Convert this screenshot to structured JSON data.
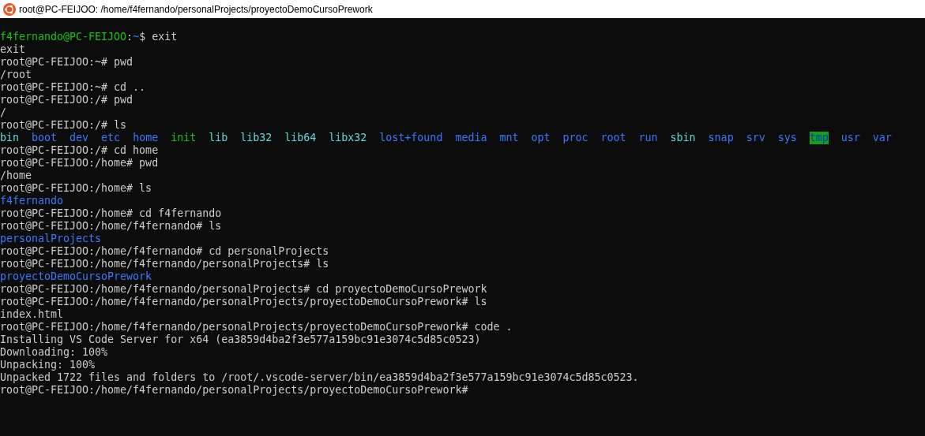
{
  "window": {
    "title": "root@PC-FEIJOO: /home/f4fernando/personalProjects/proyectoDemoCursoPrework"
  },
  "terminal": {
    "lines": [
      {
        "kind": "text",
        "segments": [
          {
            "text": "f4fernando@PC-FEIJOO",
            "kind": "user"
          },
          {
            "text": ":",
            "kind": "plain"
          },
          {
            "text": "~",
            "kind": "path"
          },
          {
            "text": "$ exit",
            "kind": "plain"
          }
        ]
      },
      {
        "kind": "text",
        "segments": [
          {
            "text": "exit",
            "kind": "plain"
          }
        ]
      },
      {
        "kind": "text",
        "segments": [
          {
            "text": "root@PC-FEIJOO:~# pwd",
            "kind": "plain"
          }
        ]
      },
      {
        "kind": "text",
        "segments": [
          {
            "text": "/root",
            "kind": "plain"
          }
        ]
      },
      {
        "kind": "text",
        "segments": [
          {
            "text": "root@PC-FEIJOO:~# cd ..",
            "kind": "plain"
          }
        ]
      },
      {
        "kind": "text",
        "segments": [
          {
            "text": "root@PC-FEIJOO:/# pwd",
            "kind": "plain"
          }
        ]
      },
      {
        "kind": "text",
        "segments": [
          {
            "text": "/",
            "kind": "plain"
          }
        ]
      },
      {
        "kind": "text",
        "segments": [
          {
            "text": "root@PC-FEIJOO:/# ls",
            "kind": "plain"
          }
        ]
      },
      {
        "kind": "listing",
        "segments": [
          {
            "text": "bin",
            "kind": "link"
          },
          {
            "text": "boot",
            "kind": "dir"
          },
          {
            "text": "dev",
            "kind": "dir"
          },
          {
            "text": "etc",
            "kind": "dir"
          },
          {
            "text": "home",
            "kind": "dir"
          },
          {
            "text": "init",
            "kind": "exec"
          },
          {
            "text": "lib",
            "kind": "link"
          },
          {
            "text": "lib32",
            "kind": "link"
          },
          {
            "text": "lib64",
            "kind": "link"
          },
          {
            "text": "libx32",
            "kind": "link"
          },
          {
            "text": "lost+found",
            "kind": "dir"
          },
          {
            "text": "media",
            "kind": "dir"
          },
          {
            "text": "mnt",
            "kind": "dir"
          },
          {
            "text": "opt",
            "kind": "dir"
          },
          {
            "text": "proc",
            "kind": "dir"
          },
          {
            "text": "root",
            "kind": "dir"
          },
          {
            "text": "run",
            "kind": "dir"
          },
          {
            "text": "sbin",
            "kind": "link"
          },
          {
            "text": "snap",
            "kind": "dir"
          },
          {
            "text": "srv",
            "kind": "dir"
          },
          {
            "text": "sys",
            "kind": "dir"
          },
          {
            "text": "tmp",
            "kind": "sticky"
          },
          {
            "text": "usr",
            "kind": "dir"
          },
          {
            "text": "var",
            "kind": "dir"
          }
        ]
      },
      {
        "kind": "text",
        "segments": [
          {
            "text": "root@PC-FEIJOO:/# cd home",
            "kind": "plain"
          }
        ]
      },
      {
        "kind": "text",
        "segments": [
          {
            "text": "root@PC-FEIJOO:/home# pwd",
            "kind": "plain"
          }
        ]
      },
      {
        "kind": "text",
        "segments": [
          {
            "text": "/home",
            "kind": "plain"
          }
        ]
      },
      {
        "kind": "text",
        "segments": [
          {
            "text": "root@PC-FEIJOO:/home# ls",
            "kind": "plain"
          }
        ]
      },
      {
        "kind": "listing",
        "segments": [
          {
            "text": "f4fernando",
            "kind": "dir"
          }
        ]
      },
      {
        "kind": "text",
        "segments": [
          {
            "text": "root@PC-FEIJOO:/home# cd f4fernando",
            "kind": "plain"
          }
        ]
      },
      {
        "kind": "text",
        "segments": [
          {
            "text": "root@PC-FEIJOO:/home/f4fernando# ls",
            "kind": "plain"
          }
        ]
      },
      {
        "kind": "listing",
        "segments": [
          {
            "text": "personalProjects",
            "kind": "dir"
          }
        ]
      },
      {
        "kind": "text",
        "segments": [
          {
            "text": "root@PC-FEIJOO:/home/f4fernando# cd personalProjects",
            "kind": "plain"
          }
        ]
      },
      {
        "kind": "text",
        "segments": [
          {
            "text": "root@PC-FEIJOO:/home/f4fernando/personalProjects# ls",
            "kind": "plain"
          }
        ]
      },
      {
        "kind": "listing",
        "segments": [
          {
            "text": "proyectoDemoCursoPrework",
            "kind": "dir"
          }
        ]
      },
      {
        "kind": "text",
        "segments": [
          {
            "text": "root@PC-FEIJOO:/home/f4fernando/personalProjects# cd proyectoDemoCursoPrework",
            "kind": "plain"
          }
        ]
      },
      {
        "kind": "text",
        "segments": [
          {
            "text": "root@PC-FEIJOO:/home/f4fernando/personalProjects/proyectoDemoCursoPrework# ls",
            "kind": "plain"
          }
        ]
      },
      {
        "kind": "listing",
        "segments": [
          {
            "text": "index.html",
            "kind": "plain"
          }
        ]
      },
      {
        "kind": "text",
        "segments": [
          {
            "text": "root@PC-FEIJOO:/home/f4fernando/personalProjects/proyectoDemoCursoPrework# code .",
            "kind": "plain"
          }
        ]
      },
      {
        "kind": "text",
        "segments": [
          {
            "text": "Installing VS Code Server for x64 (ea3859d4ba2f3e577a159bc91e3074c5d85c0523)",
            "kind": "plain"
          }
        ]
      },
      {
        "kind": "text",
        "segments": [
          {
            "text": "Downloading: 100%",
            "kind": "plain"
          }
        ]
      },
      {
        "kind": "text",
        "segments": [
          {
            "text": "Unpacking: 100%",
            "kind": "plain"
          }
        ]
      },
      {
        "kind": "text",
        "segments": [
          {
            "text": "Unpacked 1722 files and folders to /root/.vscode-server/bin/ea3859d4ba2f3e577a159bc91e3074c5d85c0523.",
            "kind": "plain"
          }
        ]
      },
      {
        "kind": "text",
        "segments": [
          {
            "text": "root@PC-FEIJOO:/home/f4fernando/personalProjects/proyectoDemoCursoPrework#",
            "kind": "plain"
          }
        ]
      }
    ]
  }
}
